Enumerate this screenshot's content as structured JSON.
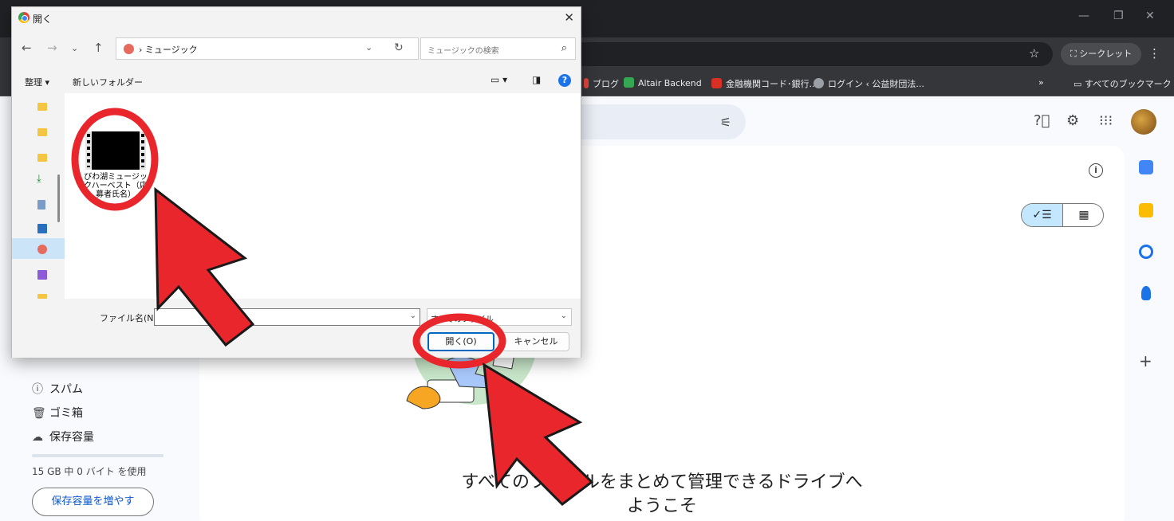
{
  "browser": {
    "incognito_label": "シークレット",
    "bookmarks": [
      {
        "label": "ブログ",
        "color": "#e8453c"
      },
      {
        "label": "Altair Backend",
        "color": "#34a853"
      },
      {
        "label": "金融機関コード･銀行...",
        "color": "#d93025"
      },
      {
        "label": "ログイン ‹ 公益財団法...",
        "color": "#9aa0a6"
      }
    ],
    "bookmarks_more": "»",
    "all_bookmarks_label": "すべてのブックマーク"
  },
  "drive": {
    "left_nav": [
      {
        "icon": "spam-icon",
        "label": "スパム"
      },
      {
        "icon": "trash-icon",
        "label": "ゴミ箱"
      },
      {
        "icon": "cloud-icon",
        "label": "保存容量"
      }
    ],
    "storage_text": "15 GB 中 0 バイト を使用",
    "storage_button": "保存容量を増やす",
    "welcome_line1": "すべてのファイルをまとめて管理できるドライブへ",
    "welcome_line2": "ようこそ",
    "rail_plus": "+"
  },
  "dialog": {
    "title": "開く",
    "address_path": "› ミュージック",
    "search_placeholder": "ミュージックの検索",
    "organize_label": "整理 ▾",
    "new_folder_label": "新しいフォルダー",
    "file_name": "びわ湖ミュージックハーベスト（応募者氏名）",
    "file_name_label": "ファイル名(N):",
    "file_name_value": "",
    "file_type_value": "すべてのファイル",
    "open_button": "開く(O)",
    "cancel_button": "キャンセル"
  },
  "colors": {
    "annotation_red": "#e8262b",
    "dialog_accent": "#0067c0",
    "drive_selected": "#c2e7ff"
  }
}
